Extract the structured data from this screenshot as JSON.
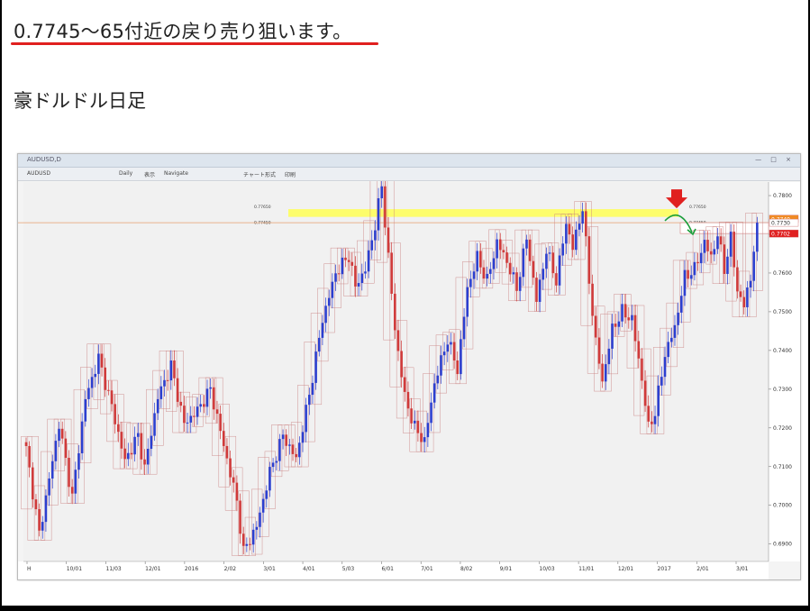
{
  "page": {
    "heading": "0.7745～65付近の戻り売り狙います。",
    "subtitle": "豪ドルドル日足"
  },
  "window": {
    "title": "AUDUSD,D",
    "toolbar": [
      "AUDUSD",
      "Daily",
      "表示",
      "Navigate",
      "チャート形式",
      "印刷"
    ],
    "controls": "— □ ×"
  },
  "chart_data": {
    "type": "candlestick",
    "symbol": "AUDUSD",
    "timeframe": "Daily",
    "y_ticks": [
      "0.7800",
      "0.7700",
      "0.7600",
      "0.7500",
      "0.7400",
      "0.7300",
      "0.7200",
      "0.7100",
      "0.7000",
      "0.6900"
    ],
    "ylim": [
      0.6855,
      0.7835
    ],
    "x_ticks": [
      "H",
      "10/01",
      "11/03",
      "12/01",
      "2016",
      "2/02",
      "3/01",
      "4/01",
      "5/03",
      "6/01",
      "7/01",
      "8/02",
      "9/01",
      "10/03",
      "11/01",
      "12/01",
      "2017",
      "2/01",
      "3/01"
    ],
    "zone": {
      "top": 0.7765,
      "bottom": 0.7745
    },
    "zone_labels": [
      "0.77650",
      "0.77450"
    ],
    "horizontal_line": 0.773,
    "price_tags": [
      {
        "label": "0.7740",
        "value": 0.774,
        "color": "#f08a24"
      },
      {
        "label": "0.7730",
        "value": 0.773,
        "color": "#ffffff"
      },
      {
        "label": "0.7702",
        "value": 0.7702,
        "color": "#e02020"
      }
    ],
    "arrow_color": "#e0201f",
    "projection_color": "#1a9e3a",
    "colors": {
      "bull": "#2b3fd0",
      "bear": "#d03a3a",
      "box": "#c87a7a",
      "zone": "#ffff55"
    },
    "path": [
      [
        0,
        0.7145
      ],
      [
        4,
        0.6925
      ],
      [
        10,
        0.721
      ],
      [
        14,
        0.702
      ],
      [
        18,
        0.7275
      ],
      [
        22,
        0.738
      ],
      [
        26,
        0.7255
      ],
      [
        30,
        0.7115
      ],
      [
        34,
        0.718
      ],
      [
        36,
        0.7095
      ],
      [
        40,
        0.728
      ],
      [
        44,
        0.736
      ],
      [
        48,
        0.721
      ],
      [
        52,
        0.7245
      ],
      [
        56,
        0.73
      ],
      [
        60,
        0.7155
      ],
      [
        64,
        0.701
      ],
      [
        66,
        0.688
      ],
      [
        70,
        0.6945
      ],
      [
        74,
        0.7085
      ],
      [
        78,
        0.718
      ],
      [
        82,
        0.712
      ],
      [
        86,
        0.7285
      ],
      [
        90,
        0.748
      ],
      [
        94,
        0.76
      ],
      [
        98,
        0.7645
      ],
      [
        100,
        0.7565
      ],
      [
        103,
        0.761
      ],
      [
        106,
        0.7725
      ],
      [
        108,
        0.7825
      ],
      [
        110,
        0.764
      ],
      [
        112,
        0.7455
      ],
      [
        115,
        0.728
      ],
      [
        118,
        0.72
      ],
      [
        121,
        0.7165
      ],
      [
        124,
        0.7315
      ],
      [
        128,
        0.743
      ],
      [
        131,
        0.735
      ],
      [
        134,
        0.756
      ],
      [
        137,
        0.764
      ],
      [
        140,
        0.758
      ],
      [
        143,
        0.768
      ],
      [
        146,
        0.763
      ],
      [
        149,
        0.756
      ],
      [
        152,
        0.769
      ],
      [
        155,
        0.753
      ],
      [
        158,
        0.766
      ],
      [
        161,
        0.758
      ],
      [
        164,
        0.773
      ],
      [
        166,
        0.7665
      ],
      [
        169,
        0.777
      ],
      [
        171,
        0.758
      ],
      [
        173,
        0.742
      ],
      [
        175,
        0.732
      ],
      [
        178,
        0.7455
      ],
      [
        181,
        0.75
      ],
      [
        184,
        0.748
      ],
      [
        187,
        0.7325
      ],
      [
        189,
        0.72
      ],
      [
        191,
        0.724
      ],
      [
        194,
        0.739
      ],
      [
        197,
        0.746
      ],
      [
        200,
        0.759
      ],
      [
        203,
        0.761
      ],
      [
        206,
        0.768
      ],
      [
        208,
        0.764
      ],
      [
        210,
        0.77
      ],
      [
        212,
        0.761
      ],
      [
        214,
        0.769
      ],
      [
        216,
        0.7555
      ],
      [
        218,
        0.7515
      ],
      [
        220,
        0.759
      ],
      [
        222,
        0.773
      ]
    ]
  }
}
